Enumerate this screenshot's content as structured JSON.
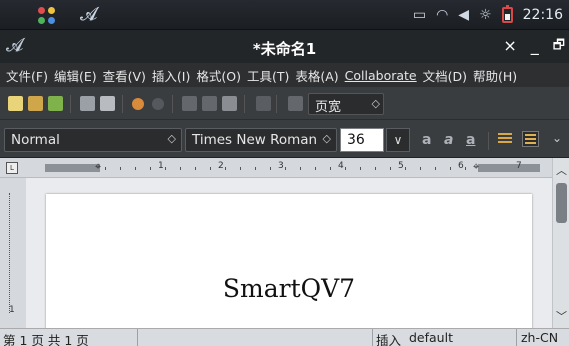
{
  "system_bar": {
    "icons": [
      "apps-icon",
      "app-logo-icon",
      "window-icon",
      "wifi-icon",
      "volume-icon",
      "brightness-icon",
      "battery-icon"
    ],
    "clock": "22:16",
    "battery_color": "#d84a4a"
  },
  "window": {
    "title": "*未命名1",
    "close_label": "×",
    "minimize_label": "_",
    "restore_label": "🗗"
  },
  "menu": {
    "items": [
      {
        "label": "文件(F)"
      },
      {
        "label": "编辑(E)"
      },
      {
        "label": "查看(V)"
      },
      {
        "label": "插入(I)"
      },
      {
        "label": "格式(O)"
      },
      {
        "label": "工具(T)"
      },
      {
        "label": "表格(A)"
      },
      {
        "label": "Collaborate"
      },
      {
        "label": "文档(D)"
      },
      {
        "label": "帮助(H)"
      }
    ]
  },
  "toolbar": {
    "zoom_value": "页宽",
    "spin_label": "◇"
  },
  "format_bar": {
    "style_value": "Normal",
    "font_value": "Times New Roman",
    "size_value": "36",
    "dropdown_label": "∨",
    "bold_label": "a",
    "italic_label": "a",
    "underline_label": "a"
  },
  "ruler": {
    "numbers": [
      "1",
      "2",
      "3",
      "4",
      "5",
      "6",
      "7"
    ]
  },
  "vruler": {
    "numbers": [
      "1"
    ]
  },
  "document": {
    "text": "SmartQV7"
  },
  "status": {
    "page_info": "第 1 页 共 1 页",
    "mode": "插入",
    "style": "default",
    "language": "zh-CN"
  }
}
